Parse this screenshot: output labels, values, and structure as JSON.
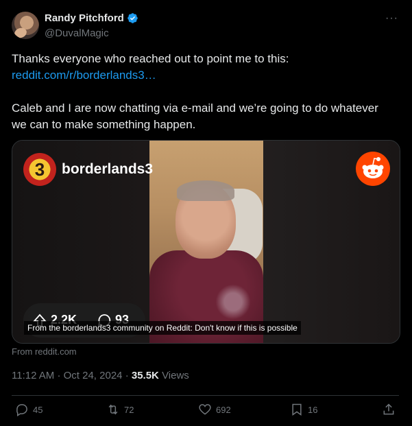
{
  "author": {
    "display_name": "Randy Pitchford",
    "handle": "@DuvalMagic",
    "verified": true
  },
  "more_icon": "more-horizontal-icon",
  "tweet": {
    "line1": "Thanks everyone who reached out to point me to this:",
    "link": "reddit.com/r/borderlands3…",
    "line2": "Caleb and I are now chatting via e-mail and we’re going to do whatever",
    "line3": "we can to make something happen."
  },
  "card": {
    "subreddit_logo_glyph": "3",
    "subreddit": "borderlands3",
    "upvotes": "2.2K",
    "comments": "93",
    "caption": "From the borderlands3 community on Reddit: Don't know if this is possible",
    "source": "From reddit.com"
  },
  "meta": {
    "time": "11:12 AM",
    "date": "Oct 24, 2024",
    "views_count": "35.5K",
    "views_label": "Views"
  },
  "actions": {
    "replies": "45",
    "retweets": "72",
    "likes": "692",
    "bookmarks": "16"
  },
  "colors": {
    "background": "#000000",
    "link": "#1d9bf0",
    "muted": "#71767b",
    "verified": "#1d9bf0",
    "reddit": "#ff4500"
  }
}
